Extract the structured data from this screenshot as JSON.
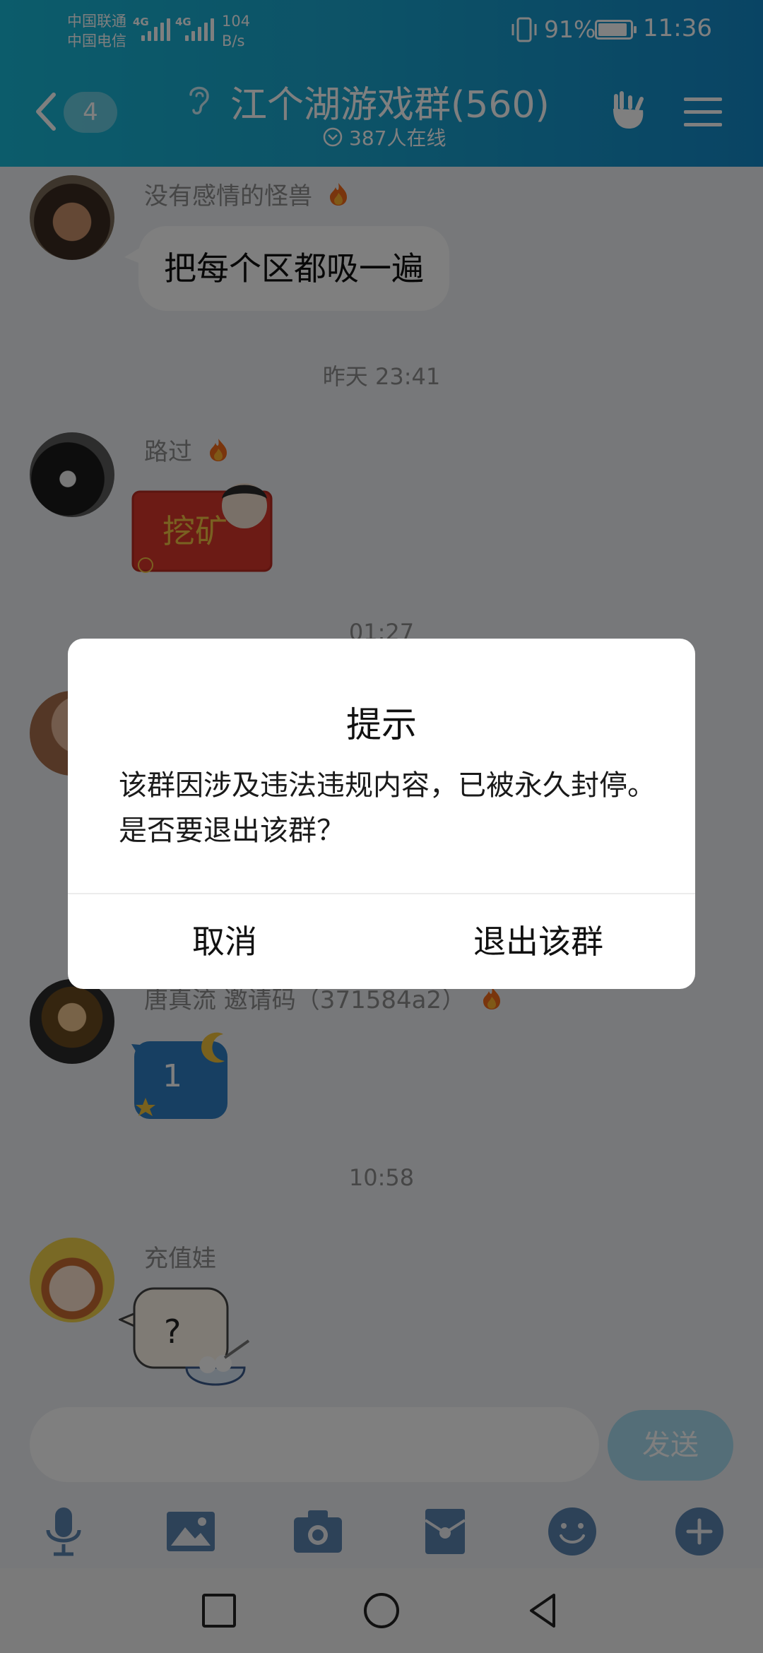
{
  "status_bar": {
    "carrier_1": "中国联通",
    "carrier_2": "中国电信",
    "sim_tag_1": "4G",
    "sim_tag_2": "4G",
    "net_speed_value": "104",
    "net_speed_unit": "B/s",
    "battery_percent": "91%",
    "time": "11:36",
    "battery_level": 0.91
  },
  "header": {
    "back_badge": "4",
    "title": "江个湖游戏群(560)",
    "online_count": "387人在线"
  },
  "messages": [
    {
      "sender": "没有感情的怪兽",
      "text": "把每个区都吸一遍"
    },
    {
      "timestamp": "昨天 23:41"
    },
    {
      "sender": "路过",
      "sticker_text": "挖矿"
    },
    {
      "timestamp": "01:27"
    },
    {
      "sender": "唐真流 邀请码（371584a2）",
      "sticker_text": "1"
    },
    {
      "timestamp": "10:58"
    },
    {
      "sender": "充值娃",
      "sticker_text": "?"
    }
  ],
  "input": {
    "placeholder": "",
    "send_label": "发送"
  },
  "toolbar_icons": [
    "microphone-icon",
    "image-icon",
    "camera-icon",
    "red-packet-icon",
    "emoji-icon",
    "plus-icon"
  ],
  "dialog": {
    "title": "提示",
    "message": "该群因涉及违法违规内容，已被永久封停。是否要退出该群？",
    "cancel_label": "取消",
    "confirm_label": "退出该群"
  },
  "colors": {
    "header_start": "#18b8d6",
    "header_end": "#1389c9",
    "send_button": "#a8dcf0",
    "overlay": "rgba(0,0,0,0.5)"
  }
}
